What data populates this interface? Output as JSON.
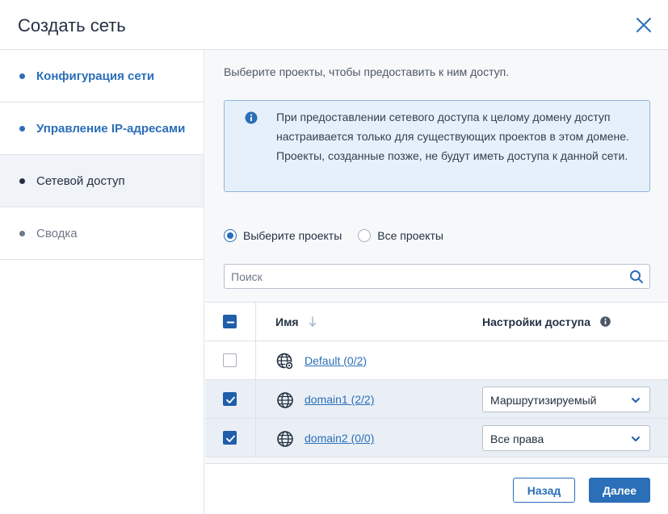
{
  "dialog": {
    "title": "Создать сеть"
  },
  "steps": [
    {
      "label": "Конфигурация сети",
      "state": "done"
    },
    {
      "label": "Управление IP-адресами",
      "state": "done"
    },
    {
      "label": "Сетевой доступ",
      "state": "current"
    },
    {
      "label": "Сводка",
      "state": "future"
    }
  ],
  "main": {
    "intro": "Выберите проекты, чтобы предоставить к ним доступ.",
    "info_text": "При предоставлении сетевого доступа к целому домену доступ настраивается только для существующих проектов в этом домене. Проекты, созданные позже, не будут иметь доступа к данной сети.",
    "radio_selected": "Выберите проекты",
    "radio_all": "Все проекты",
    "search_placeholder": "Поиск"
  },
  "table": {
    "columns": {
      "name": "Имя",
      "access": "Настройки доступа"
    },
    "rows": [
      {
        "name": "Default (0/2)",
        "checked": false,
        "icon": "globe-settings-icon",
        "access": ""
      },
      {
        "name": "domain1 (2/2)",
        "checked": true,
        "icon": "globe-icon",
        "access": "Маршрутизируемый"
      },
      {
        "name": "domain2 (0/0)",
        "checked": true,
        "icon": "globe-icon",
        "access": "Все права"
      }
    ]
  },
  "footer": {
    "back": "Назад",
    "next": "Далее"
  },
  "colors": {
    "accent": "#2a6fb8",
    "checkbox": "#1f5ea8",
    "info_bg": "#e6f0fa",
    "info_border": "#8fb5dc",
    "selected_row": "#eaeff6"
  }
}
